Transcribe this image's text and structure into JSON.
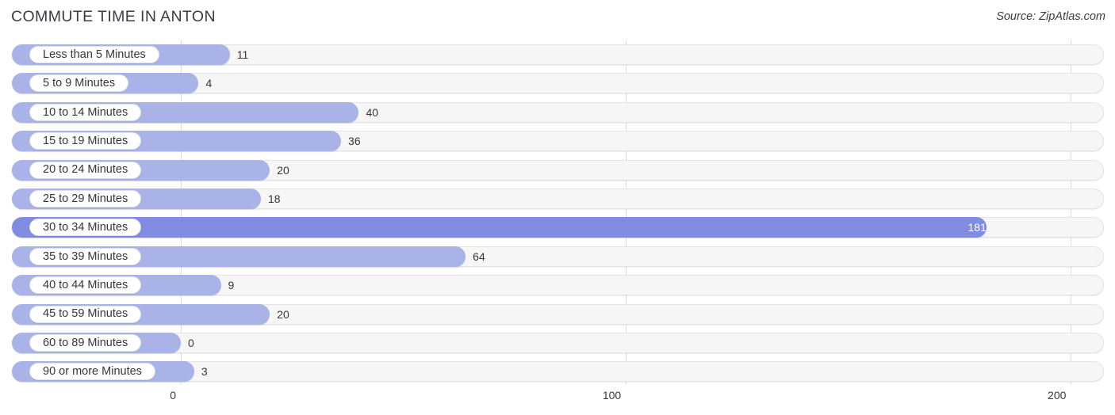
{
  "header": {
    "title": "COMMUTE TIME IN ANTON",
    "source": "Source: ZipAtlas.com"
  },
  "colors": {
    "bar": "#a9b3e8",
    "bar_highlight": "#7f8ce2",
    "track": "#f6f6f6",
    "gridline": "#dcdcdc",
    "text": "#36363c"
  },
  "chart_data": {
    "type": "bar",
    "orientation": "horizontal",
    "title": "COMMUTE TIME IN ANTON",
    "xlabel": "",
    "ylabel": "",
    "xlim": [
      0,
      200
    ],
    "xticks": [
      0,
      100,
      200
    ],
    "xtick_labels": [
      "0",
      "100",
      "200"
    ],
    "grid": true,
    "legend": false,
    "categories": [
      "Less than 5 Minutes",
      "5 to 9 Minutes",
      "10 to 14 Minutes",
      "15 to 19 Minutes",
      "20 to 24 Minutes",
      "25 to 29 Minutes",
      "30 to 34 Minutes",
      "35 to 39 Minutes",
      "40 to 44 Minutes",
      "45 to 59 Minutes",
      "60 to 89 Minutes",
      "90 or more Minutes"
    ],
    "values": [
      11,
      4,
      40,
      36,
      20,
      18,
      181,
      64,
      9,
      20,
      0,
      3
    ],
    "value_labels": [
      "11",
      "4",
      "40",
      "36",
      "20",
      "18",
      "181",
      "64",
      "9",
      "20",
      "0",
      "3"
    ],
    "highlight_index": 6
  }
}
